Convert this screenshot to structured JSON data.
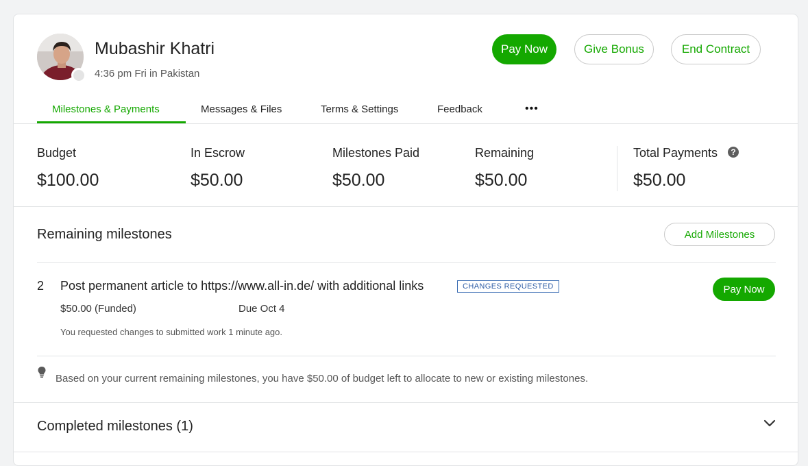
{
  "profile": {
    "name": "Mubashir Khatri",
    "local_time": "4:36 pm Fri in Pakistan"
  },
  "actions": {
    "pay_now": "Pay Now",
    "give_bonus": "Give Bonus",
    "end_contract": "End Contract"
  },
  "tabs": [
    {
      "label": "Milestones & Payments",
      "active": true
    },
    {
      "label": "Messages & Files",
      "active": false
    },
    {
      "label": "Terms & Settings",
      "active": false
    },
    {
      "label": "Feedback",
      "active": false
    }
  ],
  "more_label": "•••",
  "stats": [
    {
      "label": "Budget",
      "value": "$100.00"
    },
    {
      "label": "In Escrow",
      "value": "$50.00"
    },
    {
      "label": "Milestones Paid",
      "value": "$50.00"
    },
    {
      "label": "Remaining",
      "value": "$50.00"
    },
    {
      "label": "Total Payments",
      "value": "$50.00"
    }
  ],
  "help_icon_glyph": "?",
  "remaining": {
    "title": "Remaining milestones",
    "add_button": "Add Milestones",
    "milestone": {
      "index": "2",
      "title": "Post permanent article to https://www.all-in.de/ with additional links",
      "badge": "CHANGES REQUESTED",
      "amount": "$50.00 (Funded)",
      "due": "Due Oct 4",
      "note": "You requested changes to submitted work 1 minute ago.",
      "pay_button": "Pay Now"
    },
    "budget_note": "Based on your current remaining milestones, you have $50.00 of budget left to allocate to new or existing milestones."
  },
  "completed": {
    "title": "Completed milestones (1)"
  },
  "colors": {
    "accent": "#14a800",
    "badge": "#2f5ea6"
  }
}
